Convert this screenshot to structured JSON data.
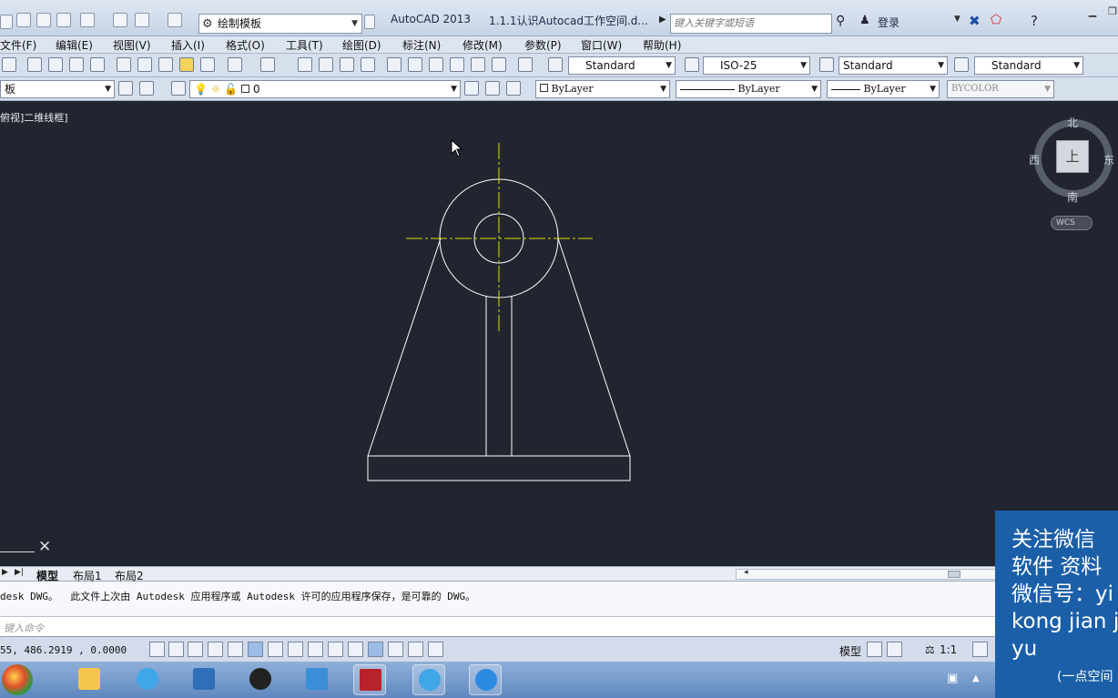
{
  "app": {
    "name": "AutoCAD 2013",
    "document": "1.1.1认识Autocad工作空间.d...",
    "workspace": "绘制模板",
    "search_placeholder": "键入关键字或短语",
    "login": "登录"
  },
  "menu": [
    "文件(F)",
    "编辑(E)",
    "视图(V)",
    "插入(I)",
    "格式(O)",
    "工具(T)",
    "绘图(D)",
    "标注(N)",
    "修改(M)",
    "参数(P)",
    "窗口(W)",
    "帮助(H)"
  ],
  "styles_toolbar": {
    "text_style": "Standard",
    "dim_style": "ISO-25",
    "table_style": "Standard",
    "multileader_style": "Standard"
  },
  "layers_toolbar": {
    "workspace_combo": "板",
    "layer": "0",
    "color": "ByLayer",
    "linetype": "ByLayer",
    "lineweight": "ByLayer",
    "plot_style": "BYCOLOR"
  },
  "viewport": {
    "label": "俯视]二维线框]"
  },
  "viewcube": {
    "north": "北",
    "south": "南",
    "east": "东",
    "west": "西",
    "face": "上",
    "wcs": "WCS"
  },
  "tabs": [
    "模型",
    "布局1",
    "布局2"
  ],
  "command": {
    "history": "desk DWG。  此文件上次由 Autodesk 应用程序或 Autodesk 许可的应用程序保存，是可靠的 DWG。",
    "placeholder": "键入命令"
  },
  "status": {
    "coords": "55, 486.2919 , 0.0000",
    "model": "模型",
    "scale": "1:1"
  },
  "overlay": {
    "line1": "关注微信 ",
    "line2": "软件 资料 ",
    "line3": "微信号：yi",
    "line4": "kong jian j",
    "line5": "yu",
    "footer": "(一点空间"
  },
  "colors": {
    "canvas": "#212530",
    "geometry": "#ffffff",
    "centerline": "#d6e000",
    "overlay": "#1b5fa8"
  }
}
